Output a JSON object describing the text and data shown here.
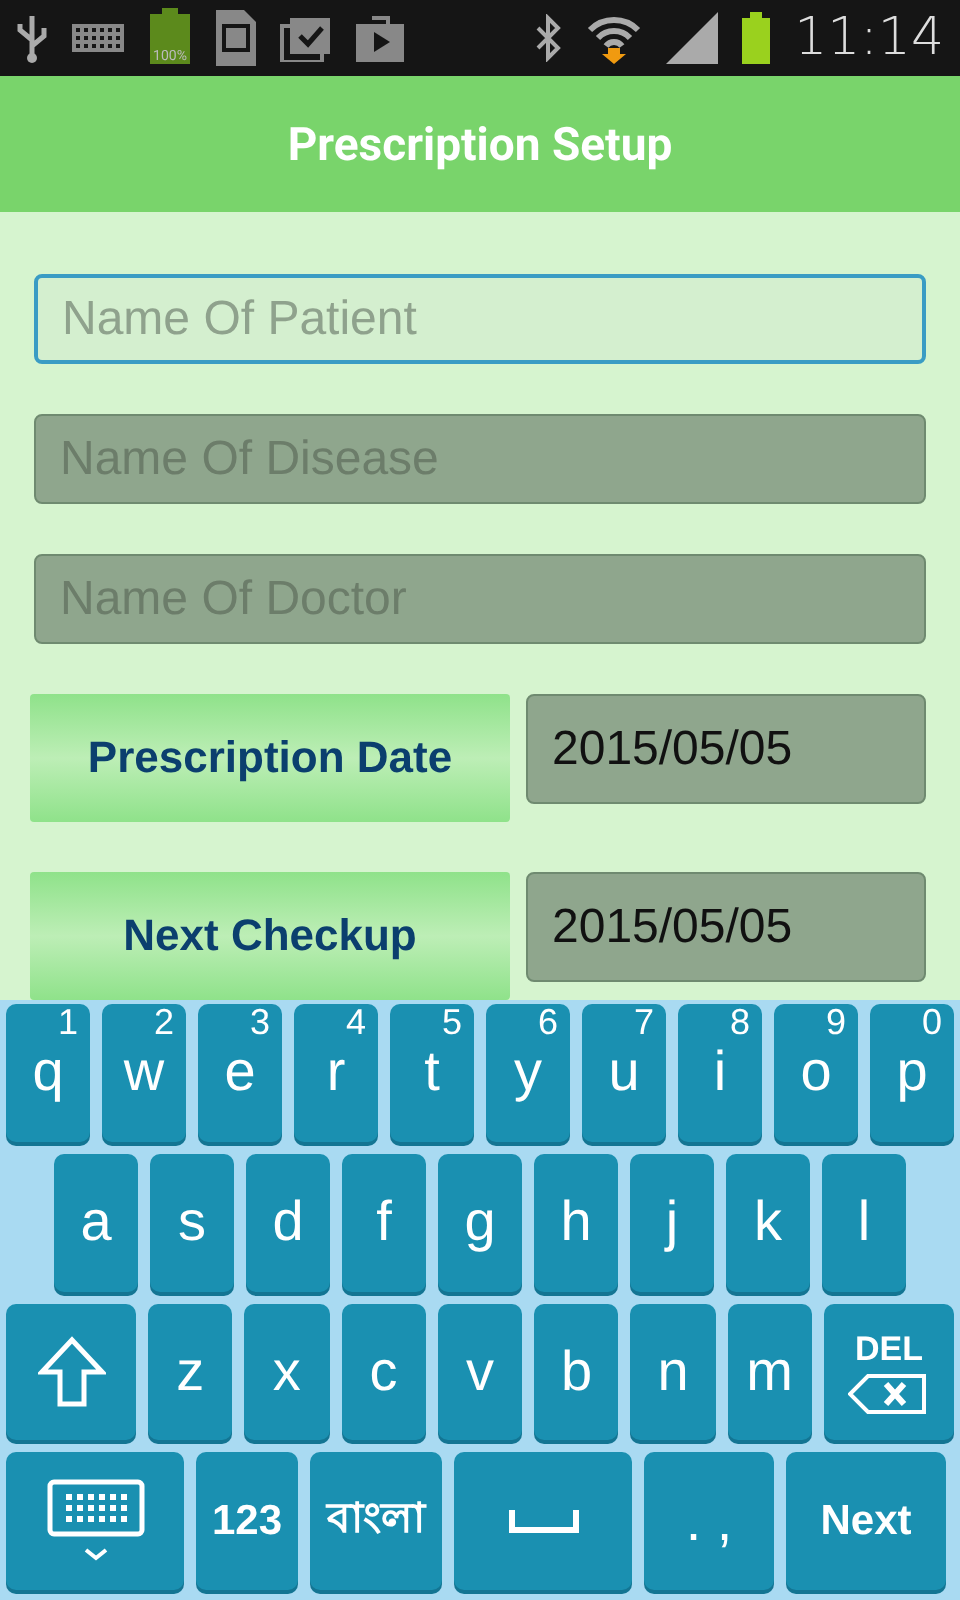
{
  "status_bar": {
    "battery_badge": "100%",
    "time": "11:14"
  },
  "header": {
    "title": "Prescription Setup"
  },
  "fields": [
    {
      "placeholder": "Name Of Patient",
      "focused": true
    },
    {
      "placeholder": "Name Of Disease",
      "focused": false
    },
    {
      "placeholder": "Name Of Doctor",
      "focused": false
    }
  ],
  "date_rows": [
    {
      "button": "Prescription Date",
      "value": "2015/05/05"
    },
    {
      "button": "Next Checkup",
      "value": "2015/05/05"
    }
  ],
  "keyboard": {
    "top_row": [
      {
        "kind": "char",
        "label": "q",
        "hint": "1"
      },
      {
        "kind": "char",
        "label": "w",
        "hint": "2"
      },
      {
        "kind": "char",
        "label": "e",
        "hint": "3"
      },
      {
        "kind": "char",
        "label": "r",
        "hint": "4"
      },
      {
        "kind": "char",
        "label": "t",
        "hint": "5"
      },
      {
        "kind": "char",
        "label": "y",
        "hint": "6"
      },
      {
        "kind": "char",
        "label": "u",
        "hint": "7"
      },
      {
        "kind": "char",
        "label": "i",
        "hint": "8"
      },
      {
        "kind": "char",
        "label": "o",
        "hint": "9"
      },
      {
        "kind": "char",
        "label": "p",
        "hint": "0"
      }
    ],
    "home_row": [
      {
        "kind": "char",
        "label": "a"
      },
      {
        "kind": "char",
        "label": "s"
      },
      {
        "kind": "char",
        "label": "d"
      },
      {
        "kind": "char",
        "label": "f"
      },
      {
        "kind": "char",
        "label": "g"
      },
      {
        "kind": "char",
        "label": "h"
      },
      {
        "kind": "char",
        "label": "j"
      },
      {
        "kind": "char",
        "label": "k"
      },
      {
        "kind": "char",
        "label": "l"
      }
    ],
    "lower_row": [
      {
        "kind": "shift"
      },
      {
        "kind": "char",
        "label": "z"
      },
      {
        "kind": "char",
        "label": "x"
      },
      {
        "kind": "char",
        "label": "c"
      },
      {
        "kind": "char",
        "label": "v"
      },
      {
        "kind": "char",
        "label": "b"
      },
      {
        "kind": "char",
        "label": "n"
      },
      {
        "kind": "char",
        "label": "m"
      },
      {
        "kind": "del",
        "label": "DEL"
      }
    ],
    "bottom_row": [
      {
        "kind": "switch"
      },
      {
        "kind": "text",
        "label": "123"
      },
      {
        "kind": "text",
        "label": "বাংলা"
      },
      {
        "kind": "space"
      },
      {
        "kind": "char",
        "label": ". ,"
      },
      {
        "kind": "text",
        "label": "Next"
      }
    ]
  }
}
